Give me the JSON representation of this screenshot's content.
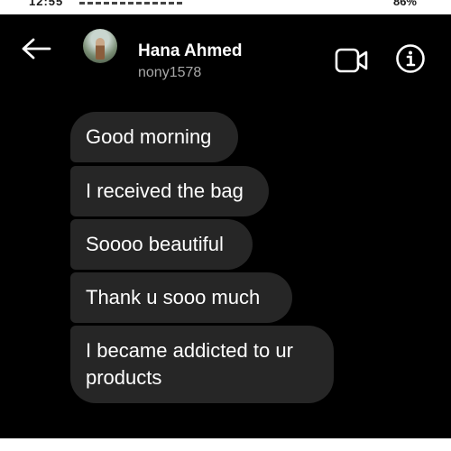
{
  "status_bar": {
    "time": "12:55",
    "battery": "86%"
  },
  "header": {
    "back_icon": "arrow-left-icon",
    "contact_name": "Hana Ahmed",
    "username": "nony1578",
    "video_icon": "video-call-icon",
    "info_icon": "info-icon"
  },
  "messages": [
    {
      "text": "Good morning"
    },
    {
      "text": "I received the bag"
    },
    {
      "text": "Soooo beautiful"
    },
    {
      "text": "Thank u sooo much"
    },
    {
      "text": "I became addicted to ur products"
    }
  ],
  "colors": {
    "background": "#000000",
    "bubble": "#262626",
    "text": "#ffffff",
    "secondary_text": "#a8a8a8"
  }
}
